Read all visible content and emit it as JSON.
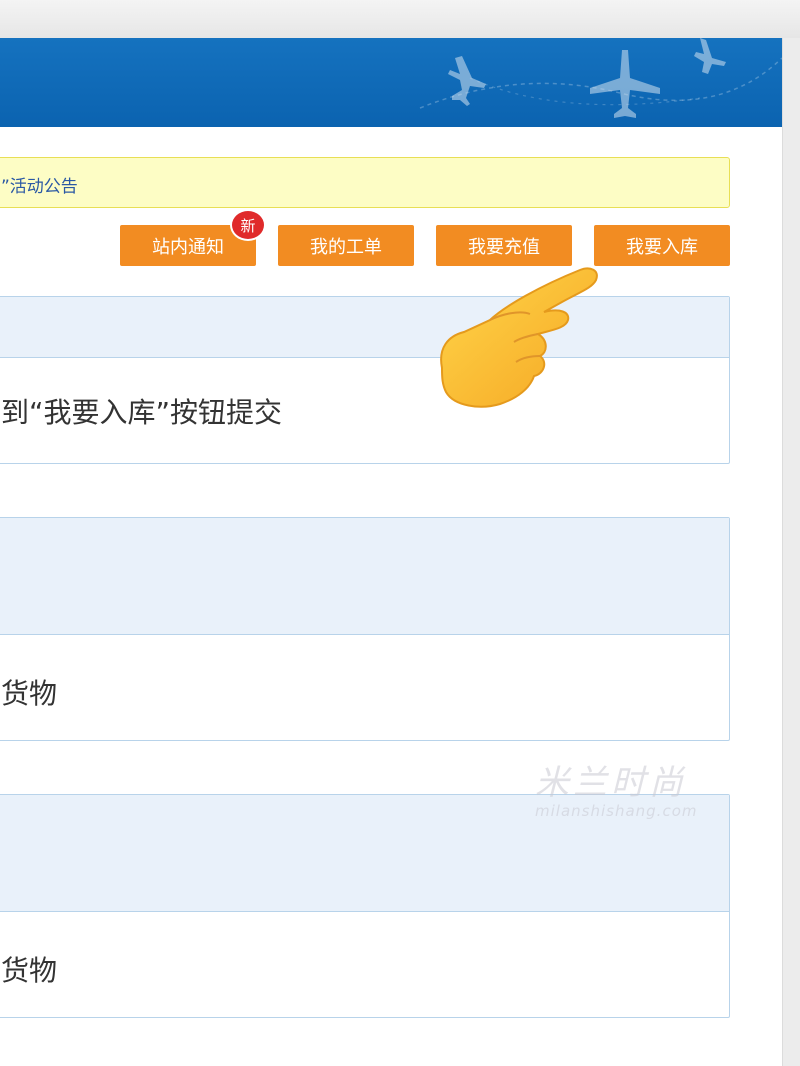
{
  "notice": {
    "text": "”活动公告"
  },
  "buttons": {
    "notify": "站内通知",
    "orders": "我的工单",
    "recharge": "我要充值",
    "stock": "我要入库"
  },
  "badge": {
    "new": "新"
  },
  "panels": [
    {
      "body": "到“我要入库”按钮提交"
    },
    {
      "body": "货物"
    },
    {
      "body": "货物"
    }
  ],
  "watermark": {
    "main": "米兰时尚",
    "sub": "milanshishang.com"
  },
  "colors": {
    "header_blue": "#0b63b0",
    "button_orange": "#f28c22",
    "badge_red": "#e02a2a",
    "notice_bg": "#fdfdc5",
    "panel_head": "#e9f1fa"
  },
  "icons": {
    "pointer": "backhand-index-pointing-right-emoji"
  }
}
